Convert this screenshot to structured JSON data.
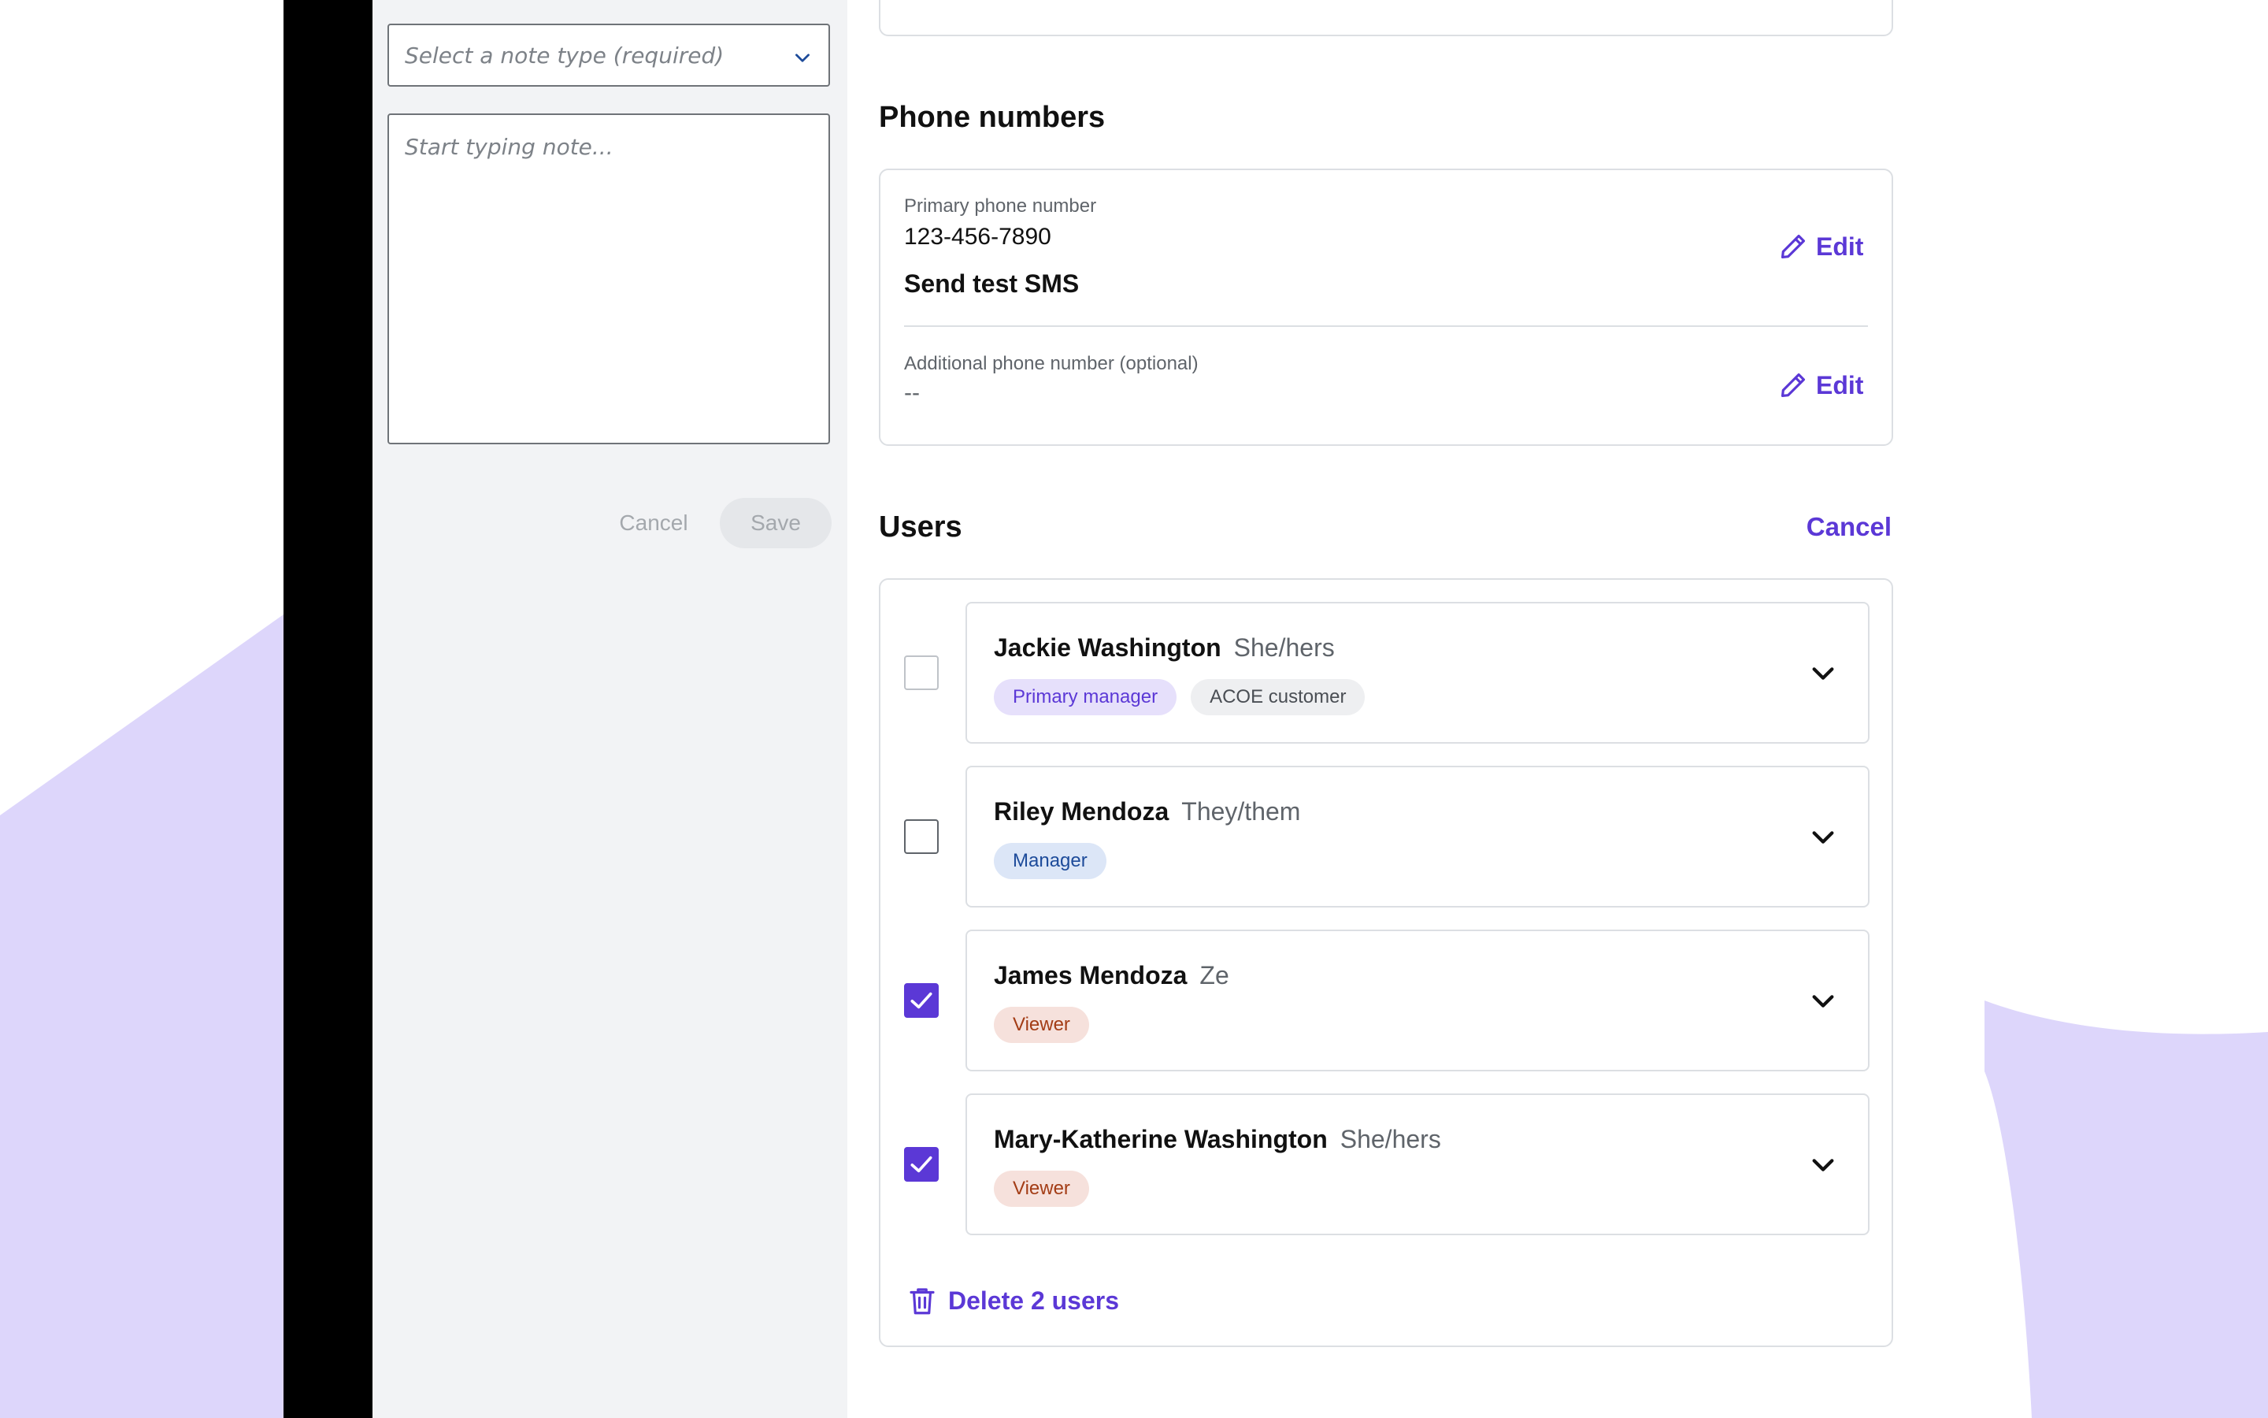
{
  "colors": {
    "accent": "#5b38d6",
    "background_shape": "#ddd6fb",
    "badge_primary_manager_bg": "#e6e0fb",
    "badge_primary_manager_fg": "#5b38d6",
    "badge_neutral_bg": "#eeeff1",
    "badge_neutral_fg": "#4a4e54",
    "badge_manager_bg": "#dce6f7",
    "badge_manager_fg": "#1d4b9a",
    "badge_viewer_bg": "#f6e1dc",
    "badge_viewer_fg": "#a33c15"
  },
  "notes": {
    "note_type_placeholder": "Select a note type (required)",
    "note_placeholder": "Start typing note...",
    "cancel_label": "Cancel",
    "save_label": "Save"
  },
  "phone_numbers": {
    "title": "Phone numbers",
    "primary_label": "Primary phone number",
    "primary_value": "123-456-7890",
    "send_test_label": "Send test SMS",
    "additional_label": "Additional phone number (optional)",
    "additional_value": "--",
    "edit_label": "Edit"
  },
  "users": {
    "title": "Users",
    "cancel_label": "Cancel",
    "delete_label": "Delete 2 users",
    "list": [
      {
        "name": "Jackie Washington",
        "pronouns": "She/hers",
        "checked": false,
        "badges": [
          {
            "label": "Primary manager",
            "kind": "primary"
          },
          {
            "label": "ACOE customer",
            "kind": "neutral"
          }
        ]
      },
      {
        "name": "Riley Mendoza",
        "pronouns": "They/them",
        "checked": false,
        "badges": [
          {
            "label": "Manager",
            "kind": "manager"
          }
        ]
      },
      {
        "name": "James Mendoza",
        "pronouns": "Ze",
        "checked": true,
        "badges": [
          {
            "label": "Viewer",
            "kind": "viewer"
          }
        ]
      },
      {
        "name": "Mary-Katherine Washington",
        "pronouns": "She/hers",
        "checked": true,
        "badges": [
          {
            "label": "Viewer",
            "kind": "viewer"
          }
        ]
      }
    ]
  },
  "icons": {
    "select_chevron": "chevron-down-icon",
    "edit": "pencil-icon",
    "user_expand": "chevron-down-icon",
    "delete": "trash-icon",
    "check": "checkmark-icon"
  }
}
